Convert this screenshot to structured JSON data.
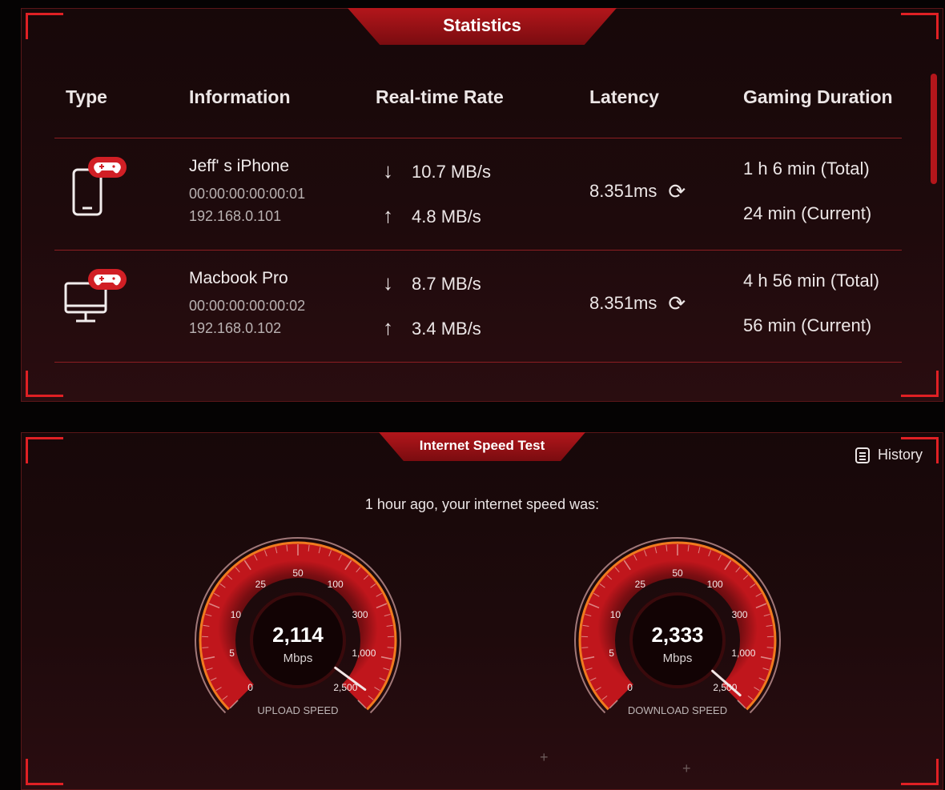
{
  "statistics": {
    "title": "Statistics",
    "columns": [
      "Type",
      "Information",
      "Real-time Rate",
      "Latency",
      "Gaming Duration"
    ],
    "devices": [
      {
        "type_icon": "phone-gamepad-icon",
        "name": "Jeff' s iPhone",
        "mac": "00:00:00:00:00:01",
        "ip": "192.168.0.101",
        "download_rate": "10.7 MB/s",
        "upload_rate": "4.8 MB/s",
        "latency": "8.351ms",
        "duration_total": "1 h 6 min (Total)",
        "duration_current": "24 min (Current)"
      },
      {
        "type_icon": "desktop-gamepad-icon",
        "name": "Macbook Pro",
        "mac": "00:00:00:00:00:02",
        "ip": "192.168.0.102",
        "download_rate": "8.7 MB/s",
        "upload_rate": "3.4 MB/s",
        "latency": "8.351ms",
        "duration_total": "4 h 56 min (Total)",
        "duration_current": "56 min (Current)"
      }
    ]
  },
  "speed_test": {
    "title": "Internet Speed Test",
    "history_label": "History",
    "note": "1 hour ago, your internet speed was:",
    "scale_ticks": [
      "0",
      "5",
      "10",
      "25",
      "50",
      "100",
      "300",
      "1,000",
      "2,500"
    ],
    "upload": {
      "value": "2,114",
      "value_mbps": 2114,
      "unit": "Mbps",
      "label": "UPLOAD SPEED"
    },
    "download": {
      "value": "2,333",
      "value_mbps": 2333,
      "unit": "Mbps",
      "label": "DOWNLOAD SPEED"
    }
  },
  "colors": {
    "accent": "#e02024",
    "tab": "#b3161b",
    "background": "#050303"
  }
}
